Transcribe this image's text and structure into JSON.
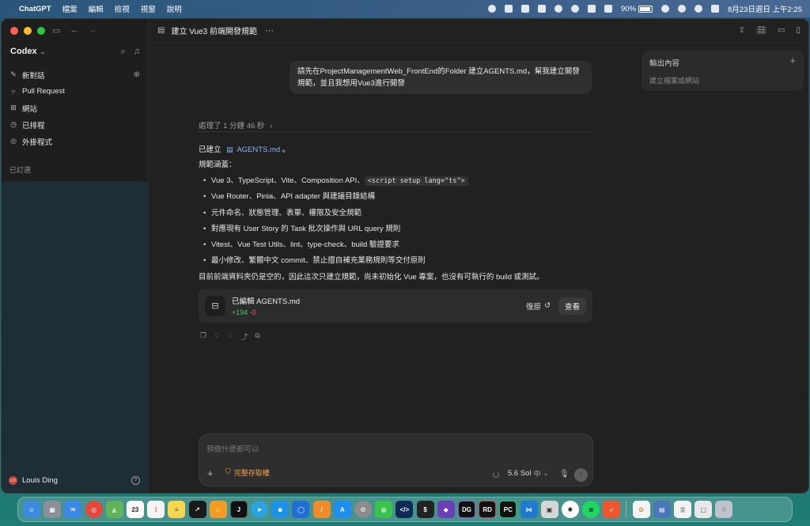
{
  "menubar": {
    "app_name": "ChatGPT",
    "menus": [
      "檔案",
      "編輯",
      "檢視",
      "視窗",
      "說明"
    ],
    "battery_percent": "90%",
    "battery_level": 0.9,
    "datetime": "8月23日週日 上午2:25"
  },
  "sidebar": {
    "title": "Codex",
    "nav": [
      {
        "label": "新對話",
        "icon": "edit-icon"
      },
      {
        "label": "Pull Request",
        "icon": "pull-request-icon"
      },
      {
        "label": "網站",
        "icon": "grid-icon"
      },
      {
        "label": "已排程",
        "icon": "clock-icon"
      },
      {
        "label": "外掛程式",
        "icon": "plugin-icon"
      }
    ],
    "section_label": "已訂選",
    "user_initials": "LD",
    "user_name": "Louis Ding"
  },
  "topbar": {
    "title": "建立 Vue3 前端開發規範"
  },
  "user_message": "請先在ProjectManagementWeb_FrontEnd的Folder 建立AGENTS.md，幫我建立開發規範，並且我想用Vue3進行開發",
  "output_panel": {
    "title": "輸出內容",
    "subtitle": "建立檔案或網站"
  },
  "processed": "處理了 1 分鐘 46 秒",
  "answer": {
    "created_prefix": "已建立",
    "created_file": "AGENTS.md",
    "created_suffix": "。",
    "scope_label": "規範涵蓋：",
    "bullet1_text": "Vue 3、TypeScript、Vite、Composition API、",
    "bullet1_code": "<script setup lang=\"ts\">",
    "bullets": [
      "Vue Router、Pinia、API adapter 與建議目錄結構",
      "元件命名、狀態管理、表單、權限及安全規範",
      "對應現有 User Story 的 Task 批次操作與 URL query 規則",
      "Vitest、Vue Test Utils、lint、type-check、build 驗證要求",
      "最小修改、繁體中文 commit、禁止擅自補充業務規則等交付原則"
    ],
    "footer": "目前前端資料夾仍是空的，因此這次只建立規範，尚未初始化 Vue 專案，也沒有可執行的 build 或測試。"
  },
  "edit_card": {
    "title": "已編輯 AGENTS.md",
    "additions": "+194",
    "deletions": "-0",
    "undo_label": "復原",
    "view_label": "查看"
  },
  "composer": {
    "placeholder": "預做什麼都可以",
    "access_label": "完整存取權",
    "model": "5.6 Sol",
    "model_sub": "中"
  },
  "dock": {
    "calendar_day": "23"
  }
}
